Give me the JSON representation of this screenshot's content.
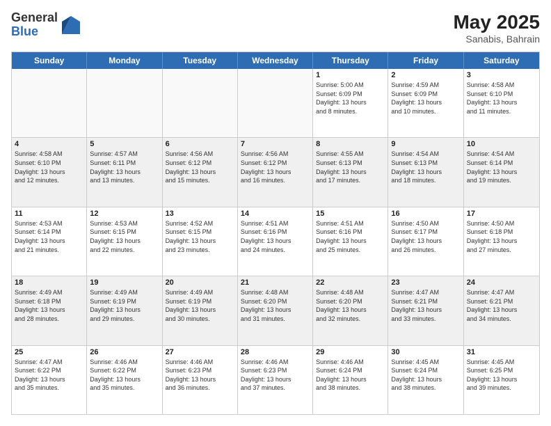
{
  "header": {
    "logo_general": "General",
    "logo_blue": "Blue",
    "title": "May 2025",
    "location": "Sanabis, Bahrain"
  },
  "days_of_week": [
    "Sunday",
    "Monday",
    "Tuesday",
    "Wednesday",
    "Thursday",
    "Friday",
    "Saturday"
  ],
  "weeks": [
    [
      {
        "day": "",
        "info": "",
        "empty": true
      },
      {
        "day": "",
        "info": "",
        "empty": true
      },
      {
        "day": "",
        "info": "",
        "empty": true
      },
      {
        "day": "",
        "info": "",
        "empty": true
      },
      {
        "day": "1",
        "info": "Sunrise: 5:00 AM\nSunset: 6:09 PM\nDaylight: 13 hours\nand 8 minutes.",
        "empty": false
      },
      {
        "day": "2",
        "info": "Sunrise: 4:59 AM\nSunset: 6:09 PM\nDaylight: 13 hours\nand 10 minutes.",
        "empty": false
      },
      {
        "day": "3",
        "info": "Sunrise: 4:58 AM\nSunset: 6:10 PM\nDaylight: 13 hours\nand 11 minutes.",
        "empty": false
      }
    ],
    [
      {
        "day": "4",
        "info": "Sunrise: 4:58 AM\nSunset: 6:10 PM\nDaylight: 13 hours\nand 12 minutes.",
        "empty": false
      },
      {
        "day": "5",
        "info": "Sunrise: 4:57 AM\nSunset: 6:11 PM\nDaylight: 13 hours\nand 13 minutes.",
        "empty": false
      },
      {
        "day": "6",
        "info": "Sunrise: 4:56 AM\nSunset: 6:12 PM\nDaylight: 13 hours\nand 15 minutes.",
        "empty": false
      },
      {
        "day": "7",
        "info": "Sunrise: 4:56 AM\nSunset: 6:12 PM\nDaylight: 13 hours\nand 16 minutes.",
        "empty": false
      },
      {
        "day": "8",
        "info": "Sunrise: 4:55 AM\nSunset: 6:13 PM\nDaylight: 13 hours\nand 17 minutes.",
        "empty": false
      },
      {
        "day": "9",
        "info": "Sunrise: 4:54 AM\nSunset: 6:13 PM\nDaylight: 13 hours\nand 18 minutes.",
        "empty": false
      },
      {
        "day": "10",
        "info": "Sunrise: 4:54 AM\nSunset: 6:14 PM\nDaylight: 13 hours\nand 19 minutes.",
        "empty": false
      }
    ],
    [
      {
        "day": "11",
        "info": "Sunrise: 4:53 AM\nSunset: 6:14 PM\nDaylight: 13 hours\nand 21 minutes.",
        "empty": false
      },
      {
        "day": "12",
        "info": "Sunrise: 4:53 AM\nSunset: 6:15 PM\nDaylight: 13 hours\nand 22 minutes.",
        "empty": false
      },
      {
        "day": "13",
        "info": "Sunrise: 4:52 AM\nSunset: 6:15 PM\nDaylight: 13 hours\nand 23 minutes.",
        "empty": false
      },
      {
        "day": "14",
        "info": "Sunrise: 4:51 AM\nSunset: 6:16 PM\nDaylight: 13 hours\nand 24 minutes.",
        "empty": false
      },
      {
        "day": "15",
        "info": "Sunrise: 4:51 AM\nSunset: 6:16 PM\nDaylight: 13 hours\nand 25 minutes.",
        "empty": false
      },
      {
        "day": "16",
        "info": "Sunrise: 4:50 AM\nSunset: 6:17 PM\nDaylight: 13 hours\nand 26 minutes.",
        "empty": false
      },
      {
        "day": "17",
        "info": "Sunrise: 4:50 AM\nSunset: 6:18 PM\nDaylight: 13 hours\nand 27 minutes.",
        "empty": false
      }
    ],
    [
      {
        "day": "18",
        "info": "Sunrise: 4:49 AM\nSunset: 6:18 PM\nDaylight: 13 hours\nand 28 minutes.",
        "empty": false
      },
      {
        "day": "19",
        "info": "Sunrise: 4:49 AM\nSunset: 6:19 PM\nDaylight: 13 hours\nand 29 minutes.",
        "empty": false
      },
      {
        "day": "20",
        "info": "Sunrise: 4:49 AM\nSunset: 6:19 PM\nDaylight: 13 hours\nand 30 minutes.",
        "empty": false
      },
      {
        "day": "21",
        "info": "Sunrise: 4:48 AM\nSunset: 6:20 PM\nDaylight: 13 hours\nand 31 minutes.",
        "empty": false
      },
      {
        "day": "22",
        "info": "Sunrise: 4:48 AM\nSunset: 6:20 PM\nDaylight: 13 hours\nand 32 minutes.",
        "empty": false
      },
      {
        "day": "23",
        "info": "Sunrise: 4:47 AM\nSunset: 6:21 PM\nDaylight: 13 hours\nand 33 minutes.",
        "empty": false
      },
      {
        "day": "24",
        "info": "Sunrise: 4:47 AM\nSunset: 6:21 PM\nDaylight: 13 hours\nand 34 minutes.",
        "empty": false
      }
    ],
    [
      {
        "day": "25",
        "info": "Sunrise: 4:47 AM\nSunset: 6:22 PM\nDaylight: 13 hours\nand 35 minutes.",
        "empty": false
      },
      {
        "day": "26",
        "info": "Sunrise: 4:46 AM\nSunset: 6:22 PM\nDaylight: 13 hours\nand 35 minutes.",
        "empty": false
      },
      {
        "day": "27",
        "info": "Sunrise: 4:46 AM\nSunset: 6:23 PM\nDaylight: 13 hours\nand 36 minutes.",
        "empty": false
      },
      {
        "day": "28",
        "info": "Sunrise: 4:46 AM\nSunset: 6:23 PM\nDaylight: 13 hours\nand 37 minutes.",
        "empty": false
      },
      {
        "day": "29",
        "info": "Sunrise: 4:46 AM\nSunset: 6:24 PM\nDaylight: 13 hours\nand 38 minutes.",
        "empty": false
      },
      {
        "day": "30",
        "info": "Sunrise: 4:45 AM\nSunset: 6:24 PM\nDaylight: 13 hours\nand 38 minutes.",
        "empty": false
      },
      {
        "day": "31",
        "info": "Sunrise: 4:45 AM\nSunset: 6:25 PM\nDaylight: 13 hours\nand 39 minutes.",
        "empty": false
      }
    ]
  ]
}
